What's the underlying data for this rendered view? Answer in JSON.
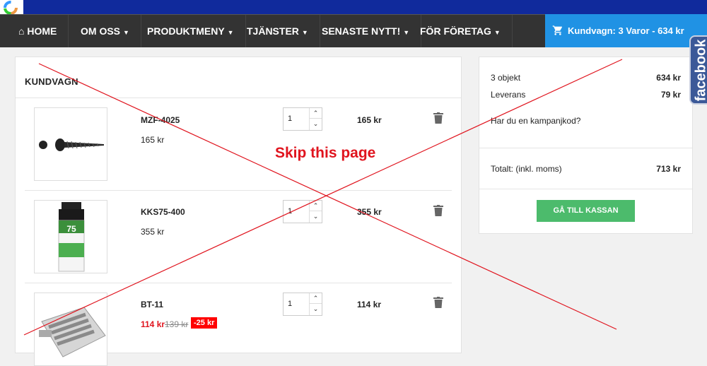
{
  "nav": {
    "home": "HOME",
    "items": [
      "OM OSS",
      "PRODUKTMENY",
      "TJÄNSTER",
      "SENASTE NYTT!",
      "FÖR FÖRETAG"
    ],
    "cart": "Kundvagn: 3 Varor - 634 kr"
  },
  "cart": {
    "title": "KUNDVAGN",
    "items": [
      {
        "name": "MZF-4025",
        "price": "165 kr",
        "qty": "1",
        "total": "165 kr"
      },
      {
        "name": "KKS75-400",
        "price": "355 kr",
        "qty": "1",
        "total": "355 kr"
      },
      {
        "name": "BT-11",
        "price": "114 kr",
        "old_price": "139 kr",
        "discount": "-25 kr",
        "qty": "1",
        "total": "114 kr"
      }
    ]
  },
  "summary": {
    "items_label": "3 objekt",
    "items_value": "634 kr",
    "shipping_label": "Leverans",
    "shipping_value": "79 kr",
    "promo": "Har du en kampanjkod?",
    "total_label": "Totalt: (inkl. moms)",
    "total_value": "713 kr",
    "checkout": "GÅ TILL KASSAN"
  },
  "facebook": "facebook",
  "overlay": {
    "text": "Skip this page",
    "color": "#e0141e"
  },
  "colors": {
    "topbar": "#102a9c",
    "nav": "#333333",
    "cart_button": "#2092e4",
    "checkout": "#4cbb6c",
    "discount": "#ff0000"
  }
}
